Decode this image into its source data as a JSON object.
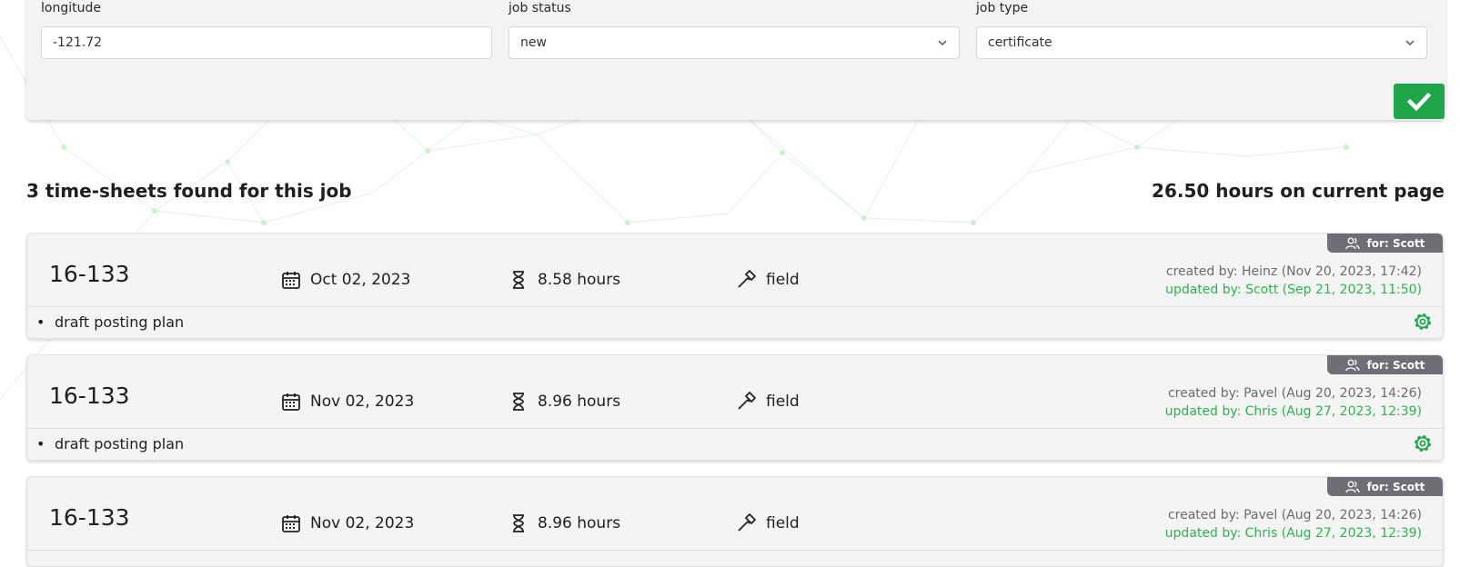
{
  "filters": {
    "longitude": {
      "label": "longitude",
      "value": "-121.72"
    },
    "job_status": {
      "label": "job status",
      "value": "new"
    },
    "job_type": {
      "label": "job type",
      "value": "certificate"
    },
    "apply_icon": "check-icon"
  },
  "summary": {
    "found_text": "3 time-sheets found for this job",
    "hours_text": "26.50 hours on current page"
  },
  "colors": {
    "accent_green": "#1fa64a",
    "badge_gray": "#6e6f76",
    "updated_green": "#2fb34f"
  },
  "timesheets": [
    {
      "job_number": "16-133",
      "date": "Oct 02, 2023",
      "hours": "8.58 hours",
      "work_type": "field",
      "assignee_badge": "for: Scott",
      "created": "created by: Heinz (Nov 20, 2023, 17:42)",
      "updated": "updated by: Scott (Sep 21, 2023, 11:50)",
      "note": "draft posting plan"
    },
    {
      "job_number": "16-133",
      "date": "Nov 02, 2023",
      "hours": "8.96 hours",
      "work_type": "field",
      "assignee_badge": "for: Scott",
      "created": "created by: Pavel (Aug 20, 2023, 14:26)",
      "updated": "updated by: Chris (Aug 27, 2023, 12:39)",
      "note": "draft posting plan"
    },
    {
      "job_number": "16-133",
      "date": "Nov 02, 2023",
      "hours": "8.96 hours",
      "work_type": "field",
      "assignee_badge": "for: Scott",
      "created": "created by: Pavel (Aug 20, 2023, 14:26)",
      "updated": "updated by: Chris (Aug 27, 2023, 12:39)",
      "note": ""
    }
  ]
}
